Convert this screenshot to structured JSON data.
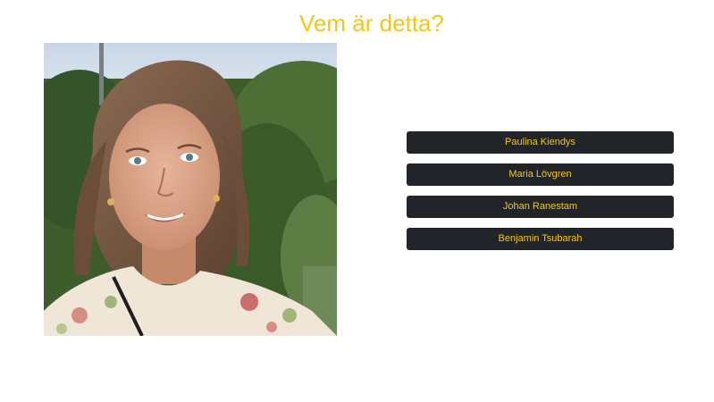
{
  "quiz": {
    "question": "Vem är detta?",
    "photo_alt": "Portrait photo",
    "options": [
      {
        "label": "Paulina Kiendys"
      },
      {
        "label": "Maria Lövgren"
      },
      {
        "label": "Johan Ranestam"
      },
      {
        "label": "Benjamin Tsubarah"
      }
    ]
  },
  "colors": {
    "accent": "#f5c518",
    "button_bg": "#212529",
    "background": "#ffffff"
  }
}
